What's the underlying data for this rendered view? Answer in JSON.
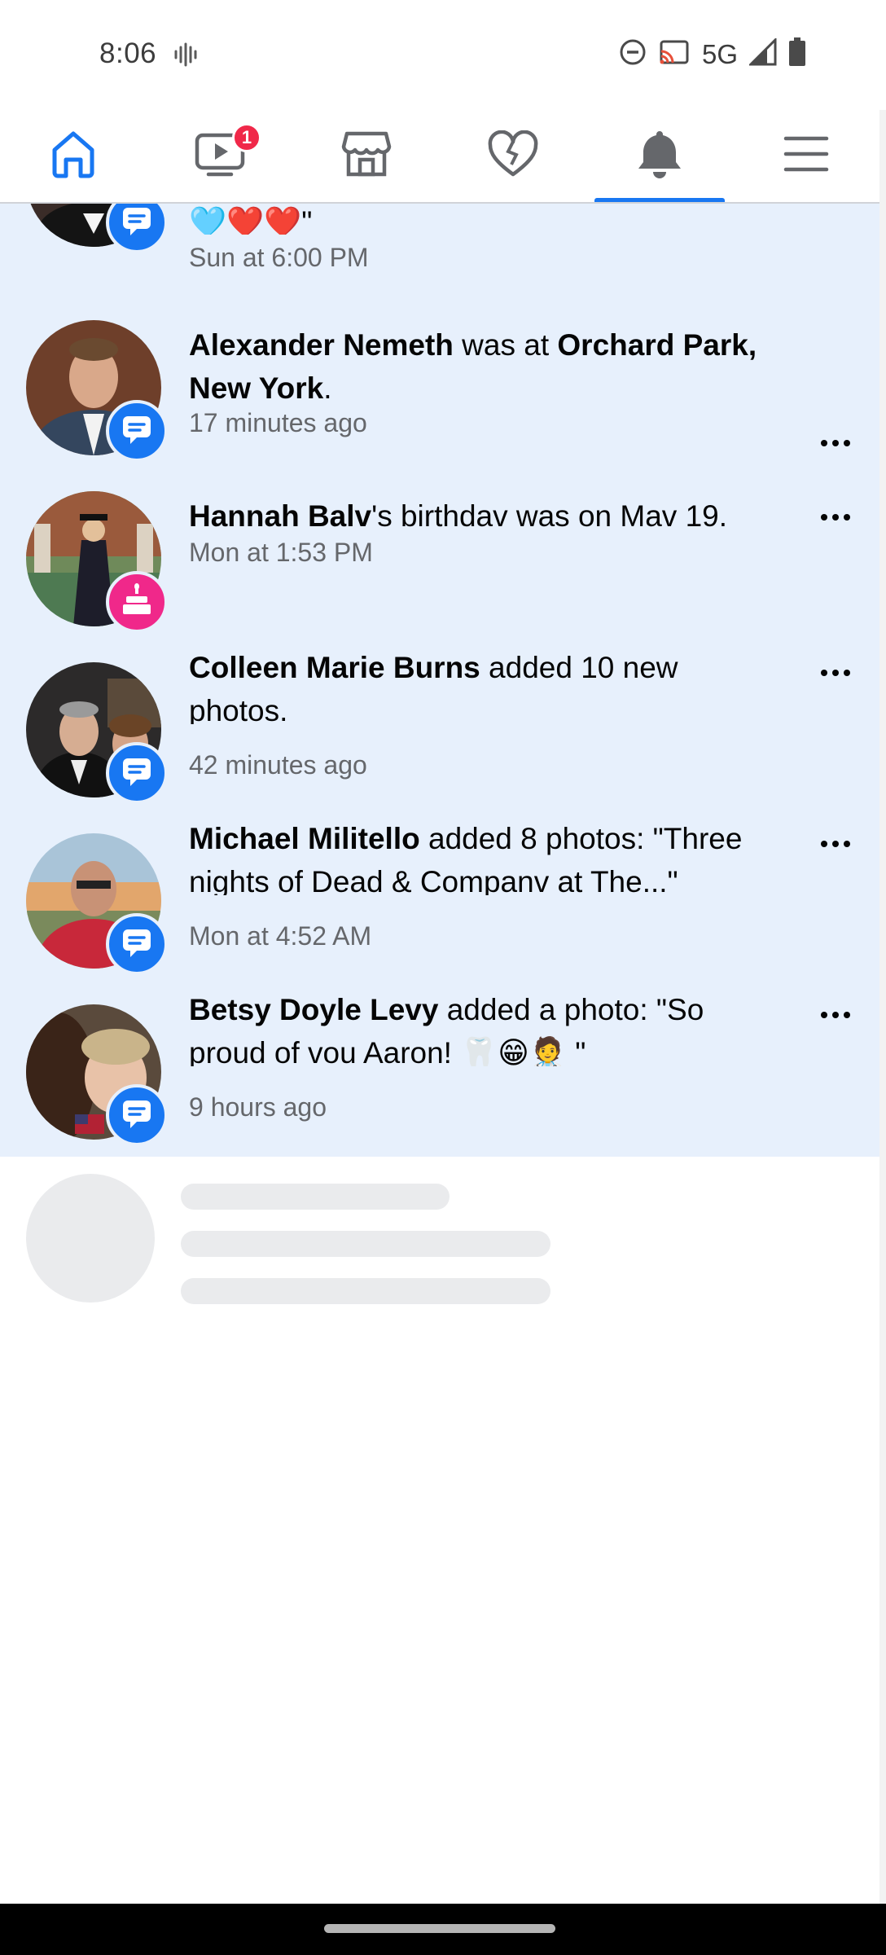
{
  "status_bar": {
    "time": "8:06",
    "network": "5G",
    "icons": [
      "vibrate-icon",
      "dnd-icon",
      "cast-icon",
      "signal-icon",
      "battery-icon"
    ]
  },
  "nav": {
    "items": [
      {
        "name": "home",
        "icon": "home-icon",
        "active": false
      },
      {
        "name": "video",
        "icon": "video-icon",
        "badge": "1",
        "active": false
      },
      {
        "name": "marketplace",
        "icon": "marketplace-icon",
        "active": false
      },
      {
        "name": "dating",
        "icon": "heart-icon",
        "active": false
      },
      {
        "name": "notifications",
        "icon": "bell-icon",
        "active": true
      },
      {
        "name": "menu",
        "icon": "menu-icon",
        "active": false
      }
    ],
    "accent": "#1877f2"
  },
  "notifications": [
    {
      "partial": true,
      "text_tail": "🩵❤️❤️\"",
      "time": "Sun at 6:00 PM",
      "badge": "comment-icon"
    },
    {
      "name": "Alexander Nemeth",
      "mid": " was at ",
      "place": "Orchard Park, New York",
      "end": ".",
      "time": "17 minutes ago",
      "badge": "comment-icon"
    },
    {
      "name": "Hannah Balv",
      "rest": "'s birthdav was on Mav 19.",
      "time": "Mon at 1:53 PM",
      "badge": "birthday-cake-icon"
    },
    {
      "name": "Colleen Marie Burns",
      "rest": " added 10 new photos.",
      "time": "42 minutes ago",
      "badge": "comment-icon"
    },
    {
      "name": "Michael Militello",
      "rest": " added 8 photos: \"Three nights of Dead & Companv at The...\"",
      "time": "Mon at 4:52 AM",
      "badge": "comment-icon"
    },
    {
      "name": "Betsy Doyle Levy",
      "rest": " added a photo: \"So proud of vou Aaron! 🦷😁🧑‍⚕️ \"",
      "time": "9 hours ago",
      "badge": "comment-icon"
    }
  ],
  "colors": {
    "unread_bg": "#e7f0fc",
    "secondary_text": "#65676b",
    "badge_red": "#f02849",
    "birthday_pink": "#f0288a"
  }
}
